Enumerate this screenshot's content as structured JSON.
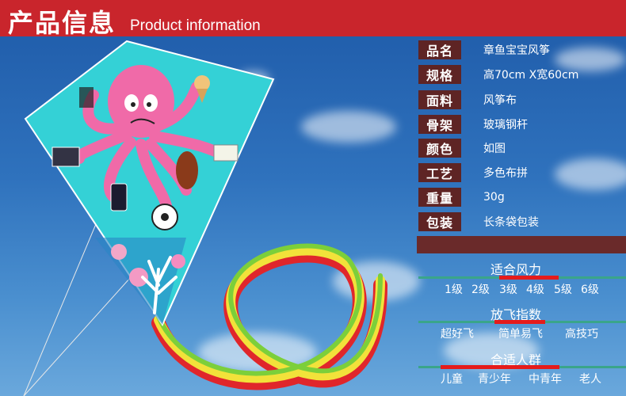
{
  "header": {
    "title_cn": "产品信息",
    "title_en": "Product information"
  },
  "specs": [
    {
      "label": "品名",
      "value": "章鱼宝宝风筝"
    },
    {
      "label": "规格",
      "value": "高70cm X宽60cm"
    },
    {
      "label": "面料",
      "value": "风筝布"
    },
    {
      "label": "骨架",
      "value": "玻璃钢杆"
    },
    {
      "label": "颜色",
      "value": "如图"
    },
    {
      "label": "工艺",
      "value": "多色布拼"
    },
    {
      "label": "重量",
      "value": "30g"
    },
    {
      "label": "包装",
      "value": "长条袋包装"
    }
  ],
  "wind": {
    "title": "适合风力",
    "levels": [
      "1级",
      "2级",
      "3级",
      "4级",
      "5级",
      "6级"
    ],
    "selected_range": "3级-5级"
  },
  "difficulty": {
    "title": "放飞指数",
    "levels": [
      "超好飞",
      "简单易飞",
      "高技巧"
    ],
    "selected": "简单易飞"
  },
  "audience": {
    "title": "合适人群",
    "levels": [
      "儿童",
      "青少年",
      "中青年",
      "老人"
    ],
    "selected_range": "儿童-中青年"
  },
  "colors": {
    "header_red": "#c9252c",
    "label_bg": "#5e2424",
    "sky_blue": "#2f72bd",
    "kite_cyan": "#34d1d6",
    "octopus_pink": "#f06aa8",
    "scale_green": "#3aa58a",
    "scale_red": "#e51b1b"
  }
}
